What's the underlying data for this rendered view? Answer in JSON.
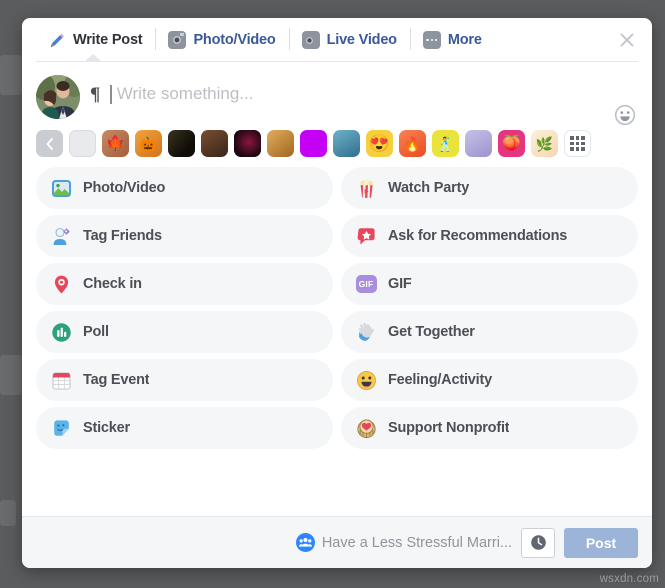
{
  "backdrop": {
    "color": "#5b5c5e"
  },
  "header": {
    "tabs": [
      {
        "label": "Write Post",
        "icon": "pencil-icon",
        "active": true
      },
      {
        "label": "Photo/Video",
        "icon": "camera-icon",
        "active": false
      },
      {
        "label": "Live Video",
        "icon": "video-camera-icon",
        "active": false
      },
      {
        "label": "More",
        "icon": "ellipsis-icon",
        "active": false
      }
    ],
    "close_label": "✕"
  },
  "compose": {
    "avatar_alt": "user-profile-photo",
    "paragraph_mark": "¶",
    "placeholder": "Write something...",
    "emoji_button": "emoji-smiley-icon"
  },
  "background_picker": {
    "prev_arrow": "‹",
    "grid_button": "grid-icon",
    "swatches": [
      {
        "name": "plain-white",
        "type": "plain",
        "color": "#e8eaed",
        "selected": true
      },
      {
        "name": "autumn-leaf",
        "type": "image",
        "color": "#b8724a",
        "glyph": "🍁"
      },
      {
        "name": "pumpkin",
        "type": "image",
        "color": "#e08a2a",
        "glyph": "🎃"
      },
      {
        "name": "dark-leaf",
        "type": "image",
        "color": "#2a2316",
        "glyph": ""
      },
      {
        "name": "acorns",
        "type": "image",
        "color": "#5b3b2a",
        "glyph": ""
      },
      {
        "name": "dark-berry",
        "type": "image",
        "color": "#2b0f18",
        "glyph": ""
      },
      {
        "name": "golden-leaf",
        "type": "image",
        "color": "#c98f3c",
        "glyph": ""
      },
      {
        "name": "magenta",
        "type": "color",
        "color": "#c400f5",
        "glyph": ""
      },
      {
        "name": "blue-abstract",
        "type": "image",
        "color": "#4c93b3",
        "glyph": ""
      },
      {
        "name": "heart-eyes",
        "type": "emoji",
        "color": "#f7d14c",
        "glyph": "😍"
      },
      {
        "name": "fire",
        "type": "emoji",
        "color": "#f4653a",
        "glyph": "🔥"
      },
      {
        "name": "dancer",
        "type": "emoji",
        "color": "#e8e234",
        "glyph": "🕺"
      },
      {
        "name": "purple-cube",
        "type": "image",
        "color": "#b3aedc",
        "glyph": ""
      },
      {
        "name": "peach",
        "type": "emoji",
        "color": "#e5357f",
        "glyph": "🍑"
      },
      {
        "name": "palm-leaf",
        "type": "image",
        "color": "#fae6cc",
        "glyph": ""
      }
    ]
  },
  "actions": {
    "left_column": [
      {
        "label": "Photo/Video",
        "icon": "photo-video-icon",
        "glyph": "🖼"
      },
      {
        "label": "Tag Friends",
        "icon": "tag-friends-icon",
        "glyph": "👤"
      },
      {
        "label": "Check in",
        "icon": "location-pin-icon",
        "glyph": "📍"
      },
      {
        "label": "Poll",
        "icon": "poll-icon",
        "glyph": "📊"
      },
      {
        "label": "Tag Event",
        "icon": "calendar-icon",
        "glyph": "📅"
      },
      {
        "label": "Sticker",
        "icon": "sticker-icon",
        "glyph": "🏝"
      }
    ],
    "right_column": [
      {
        "label": "Watch Party",
        "icon": "popcorn-icon",
        "glyph": "🍿"
      },
      {
        "label": "Ask for Recommendations",
        "icon": "speech-bubble-star-icon",
        "glyph": "💬"
      },
      {
        "label": "GIF",
        "icon": "gif-icon",
        "glyph": "GIF"
      },
      {
        "label": "Get Together",
        "icon": "waving-hand-icon",
        "glyph": "🖐"
      },
      {
        "label": "Feeling/Activity",
        "icon": "smiley-face-icon",
        "glyph": "😃"
      },
      {
        "label": "Support Nonprofit",
        "icon": "heart-coin-icon",
        "glyph": "🧡"
      }
    ]
  },
  "footer": {
    "audience_label": "Have a Less Stressful Marri...",
    "audience_icon": "group-people-icon",
    "schedule_icon": "clock-icon",
    "post_label": "Post"
  },
  "watermark": {
    "text": "wsxdn.com"
  }
}
